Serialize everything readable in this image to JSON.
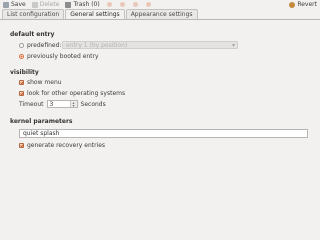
{
  "toolbar": {
    "save_label": "Save",
    "delete_label": "Delete",
    "trash_label": "Trash (0)",
    "revert_label": "Revert"
  },
  "tabs": [
    {
      "label": "List configuration"
    },
    {
      "label": "General settings"
    },
    {
      "label": "Appearance settings"
    }
  ],
  "default_entry": {
    "title": "default entry",
    "predefined_label": "predefined:",
    "predefined_value": "entry 1 (by position)",
    "previously_booted_label": "previously booted entry",
    "selected": "previously booted entry"
  },
  "visibility": {
    "title": "visibility",
    "show_menu_label": "show menu",
    "look_for_other_os_label": "look for other operating systems",
    "timeout_label": "Timeout",
    "timeout_value": "3",
    "seconds_label": "Seconds"
  },
  "kernel_parameters": {
    "title": "kernel parameters",
    "value": "quiet splash",
    "generate_recovery_label": "generate recovery entries"
  }
}
